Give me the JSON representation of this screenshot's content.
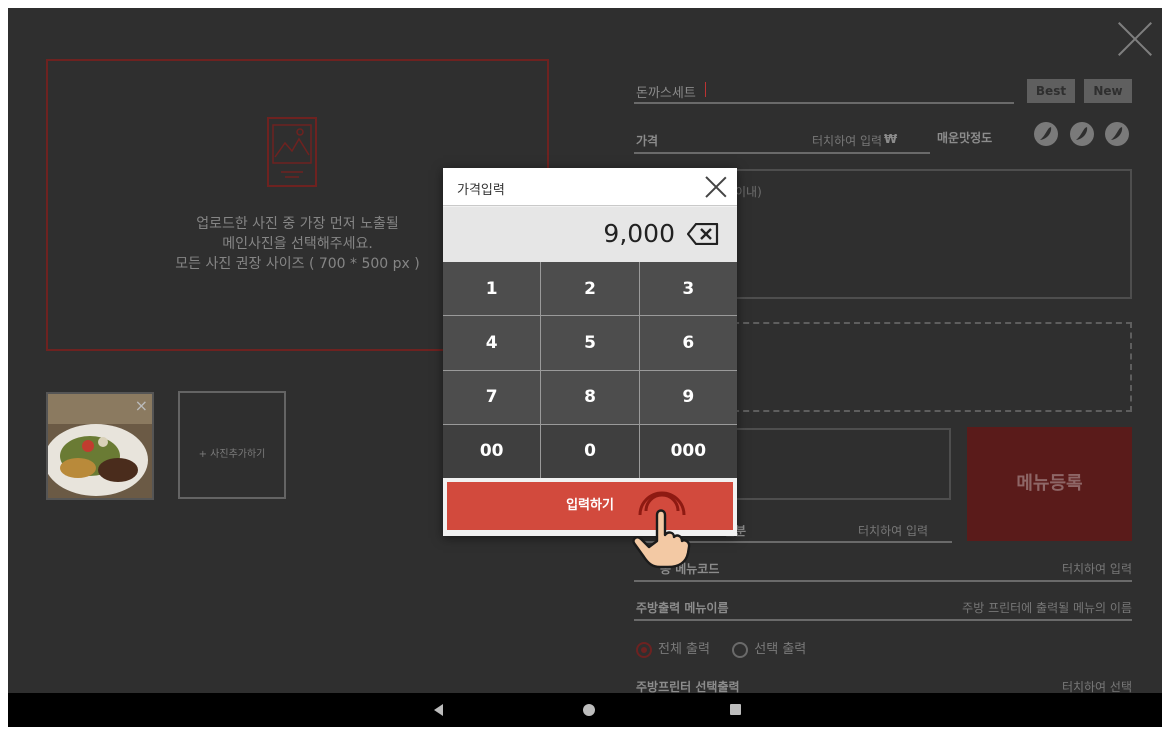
{
  "upload": {
    "line1": "업로드한 사진 중 가장 먼저 노출될",
    "line2": "메인사진을 선택해주세요.",
    "line3": "모든 사진 권장 사이즈 ( 700 * 500 px )"
  },
  "photos": {
    "thumb_close": "×",
    "add_label": "+ 사진추가하기"
  },
  "menu": {
    "name": "돈까스세트",
    "tag_best": "Best",
    "tag_new": "New",
    "price_label": "가격",
    "price_hint": "터치하여 입력",
    "currency": "₩",
    "spice_label": "매운맛정도",
    "desc_hint": "이내)",
    "register_label": "메뉴등록",
    "serving_label": "인분",
    "serving_hint": "터치하여 입력",
    "code_label": "동 메뉴코드",
    "code_hint": "터치하여 입력",
    "kitchen_name_label": "주방출력 메뉴이름",
    "kitchen_name_hint": "주방 프린터에 출력될 메뉴의 이름",
    "print_all": "전체 출력",
    "print_select": "선택 출력",
    "printer_label": "주방프린터 선택출력",
    "printer_hint": "터치하여 선택"
  },
  "dialog": {
    "title": "가격입력",
    "value": "9,000",
    "keys": [
      "1",
      "2",
      "3",
      "4",
      "5",
      "6",
      "7",
      "8",
      "9",
      "00",
      "0",
      "000"
    ],
    "enter_label": "입력하기"
  },
  "colors": {
    "background": "#2f2f2f",
    "accent": "#d24a3d",
    "keypad": "#4d4d4d"
  }
}
